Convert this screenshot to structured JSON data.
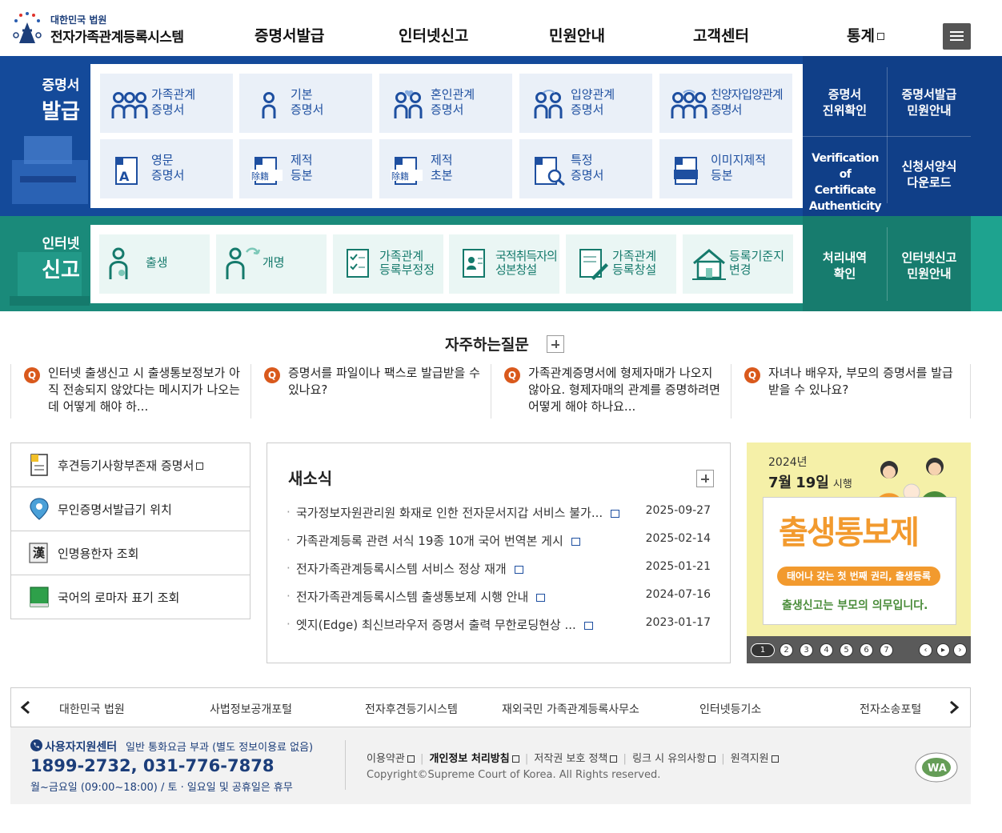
{
  "header": {
    "logo_sub": "대한민국 법원",
    "logo_main": "전자가족관계등록시스템",
    "nav": [
      "증명서발급",
      "인터넷신고",
      "민원안내",
      "고객센터",
      "통계"
    ]
  },
  "cert": {
    "title_1": "증명서",
    "title_2": "발급",
    "tiles": [
      {
        "l1": "가족관계",
        "l2": "증명서",
        "icon": "family-icon"
      },
      {
        "l1": "기본",
        "l2": "증명서",
        "icon": "person-icon"
      },
      {
        "l1": "혼인관계",
        "l2": "증명서",
        "icon": "couple-heart-icon"
      },
      {
        "l1": "입양관계",
        "l2": "증명서",
        "icon": "adoption-icon"
      },
      {
        "l1": "친양자입양관계",
        "l2": "증명서",
        "icon": "full-adoption-icon"
      },
      {
        "l1": "영문",
        "l2": "증명서",
        "icon": "english-doc-icon"
      },
      {
        "l1": "제적",
        "l2": "등본",
        "icon": "removed-register-icon"
      },
      {
        "l1": "제적",
        "l2": "초본",
        "icon": "removed-register-extract-icon"
      },
      {
        "l1": "특정",
        "l2": "증명서",
        "icon": "doc-search-icon"
      },
      {
        "l1": "이미지제적",
        "l2": "등본",
        "icon": "image-register-icon"
      }
    ],
    "side": [
      {
        "l1": "증명서",
        "l2": "진위확인"
      },
      {
        "l1": "증명서발급",
        "l2": "민원안내"
      },
      {
        "l1": "Verification of",
        "l2": "Certificate",
        "l3": "Authenticity"
      },
      {
        "l1": "신청서양식",
        "l2": "다운로드"
      }
    ]
  },
  "report": {
    "title_1": "인터넷",
    "title_2": "신고",
    "tiles": [
      {
        "l1": "출생",
        "l2": "",
        "icon": "baby-icon"
      },
      {
        "l1": "개명",
        "l2": "",
        "icon": "rename-icon"
      },
      {
        "l1": "가족관계",
        "l2": "등록부정정",
        "icon": "checklist-icon"
      },
      {
        "l1": "국적취득자의",
        "l2": "성본창설",
        "icon": "id-card-icon"
      },
      {
        "l1": "가족관계",
        "l2": "등록창설",
        "icon": "doc-pen-icon"
      },
      {
        "l1": "등록기준지",
        "l2": "변경",
        "icon": "house-icon"
      }
    ],
    "side": [
      {
        "l1": "처리내역",
        "l2": "확인"
      },
      {
        "l1": "인터넷신고",
        "l2": "민원안내"
      }
    ]
  },
  "faq": {
    "title": "자주하는질문",
    "items": [
      "인터넷 출생신고 시 출생통보정보가 아직 전송되지 않았다는 메시지가 나오는데 어떻게 해야 하...",
      "증명서를 파일이나 팩스로 발급받을 수 있나요?",
      "가족관계증명서에 형제자매가 나오지 않아요. 형제자매의 관계를 증명하려면 어떻게 해야 하나요...",
      "자녀나 배우자, 부모의 증명서를 발급받을 수 있나요?"
    ]
  },
  "quick": [
    {
      "label": "후견등기사항부존재 증명서",
      "icon": "document-icon",
      "ext": true
    },
    {
      "label": "무인증명서발급기 위치",
      "icon": "location-pin-icon",
      "ext": false
    },
    {
      "label": "인명용한자 조회",
      "icon": "hanja-book-icon",
      "ext": false
    },
    {
      "label": "국어의 로마자 표기 조회",
      "icon": "green-book-icon",
      "ext": false
    }
  ],
  "news": {
    "title": "새소식",
    "items": [
      {
        "title": "국가정보자원관리원 화재로 인한 전자문서지갑 서비스 불가...",
        "date": "2025-09-27"
      },
      {
        "title": "가족관계등록 관련 서식 19종 10개 국어 번역본 게시",
        "date": "2025-02-14"
      },
      {
        "title": "전자가족관계등록시스템 서비스 정상 재개",
        "date": "2025-01-21"
      },
      {
        "title": "전자가족관계등록시스템 출생통보제 시행 안내",
        "date": "2024-07-16"
      },
      {
        "title": "엣지(Edge) 최신브라우저 증명서 출력 무한로딩현상 ...",
        "date": "2023-01-17"
      }
    ]
  },
  "banner": {
    "year": "2024년",
    "date_month": "7월",
    "date_day": "19일",
    "date_suffix": "시행",
    "headline": "출생통보제",
    "ribbon": "태어나 갖는 첫 번째 권리, 출생등록",
    "tagline": "출생신고는 부모의 의무입니다.",
    "pages": [
      "1",
      "2",
      "3",
      "4",
      "5",
      "6",
      "7"
    ]
  },
  "sites": [
    "대한민국 법원",
    "사법정보공개포털",
    "전자후견등기시스템",
    "재외국민 가족관계등록사무소",
    "인터넷등기소",
    "전자소송포털"
  ],
  "footer": {
    "center_label": "사용자지원센터",
    "center_note": "일반 통화요금 부과 (별도 정보이용료 없음)",
    "phone": "1899-2732, 031-776-7878",
    "hours": "월~금요일 (09:00~18:00) / 토 · 일요일 및 공휴일은 휴무",
    "links": [
      "이용약관",
      "개인정보 처리방침",
      "저작권 보호 정책",
      "링크 시 유의사항",
      "원격지원"
    ],
    "copyright": "Copyright©Supreme Court of Korea. All Rights reserved.",
    "wa_mark": "WA"
  },
  "colors": {
    "cert_blue": "#144a9a",
    "report_teal": "#1a8a7a",
    "faq_orange": "#d9591c"
  }
}
